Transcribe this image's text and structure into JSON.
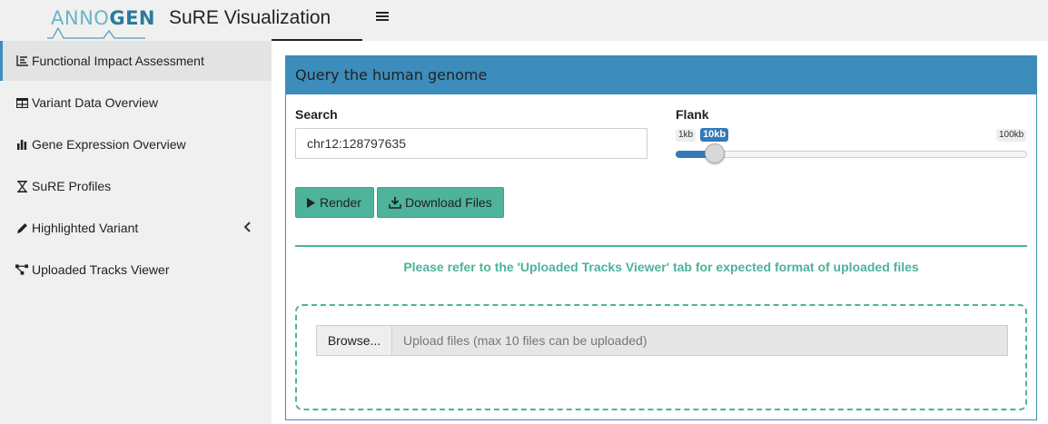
{
  "header": {
    "logo_part1": "ANNO",
    "logo_part2": "GEN",
    "title": "SuRE Visualization",
    "menu_icon": "hamburger-icon"
  },
  "sidebar": {
    "items": [
      {
        "label": "Functional Impact Assessment",
        "icon": "chart-line-icon",
        "active": true
      },
      {
        "label": "Variant Data Overview",
        "icon": "table-icon"
      },
      {
        "label": "Gene Expression Overview",
        "icon": "bar-chart-icon"
      },
      {
        "label": "SuRE Profiles",
        "icon": "hourglass-icon"
      },
      {
        "label": "Highlighted Variant",
        "icon": "pencil-icon",
        "chevron": "chevron-left-icon"
      },
      {
        "label": "Uploaded Tracks Viewer",
        "icon": "project-diagram-icon"
      }
    ]
  },
  "main": {
    "box_title": "Query the human genome",
    "search": {
      "label": "Search",
      "value": "chr12:128797635"
    },
    "flank": {
      "label": "Flank",
      "min_label": "1kb",
      "max_label": "100kb",
      "selected_label": "10kb",
      "value_fraction": 0.11
    },
    "render_label": "Render",
    "download_label": "Download Files",
    "notice": "Please refer to the 'Uploaded Tracks Viewer' tab for expected format of uploaded files",
    "upload": {
      "browse_label": "Browse...",
      "placeholder": "Upload files (max 10 files can be uploaded)"
    }
  },
  "colors": {
    "primary": "#3c8dbc",
    "accent": "#4db39b",
    "slider": "#337ab7"
  }
}
